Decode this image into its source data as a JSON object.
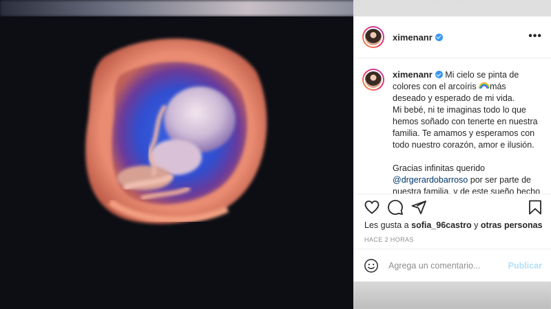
{
  "post": {
    "username": "ximenanr",
    "verified": true,
    "more_label": "•••"
  },
  "caption": {
    "username": "ximenanr",
    "text_part1": "Mi cielo se pinta de colores con el arcoíris",
    "emoji": "rainbow",
    "text_part2": "más deseado y esperado de mi vida.",
    "paragraph2": "Mi bebé, ni te imaginas todo lo que hemos soñado con tenerte en nuestra familia. Te amamos y esperamos con todo nuestro corazón, amor e ilusión.",
    "paragraph3_prefix": "Gracias infinitas querido",
    "mention": "@drgerardobarroso",
    "paragraph3_suffix": "por ser parte de",
    "paragraph3_cut": "nuestra familia, y de este sueño hecho"
  },
  "actions": {
    "like_icon": "heart-icon",
    "comment_icon": "speech-bubble-icon",
    "share_icon": "paper-plane-icon",
    "save_icon": "bookmark-icon"
  },
  "likes": {
    "prefix": "Les gusta a",
    "user": "sofia_96castro",
    "conjunction": "y",
    "others": "otras personas"
  },
  "timestamp": "HACE 2 HORAS",
  "comment": {
    "placeholder": "Agrega un comentario...",
    "publish_label": "Publicar"
  },
  "colors": {
    "verified": "#3897f0",
    "mention": "#00376b",
    "publish_disabled": "#b2dffc"
  }
}
